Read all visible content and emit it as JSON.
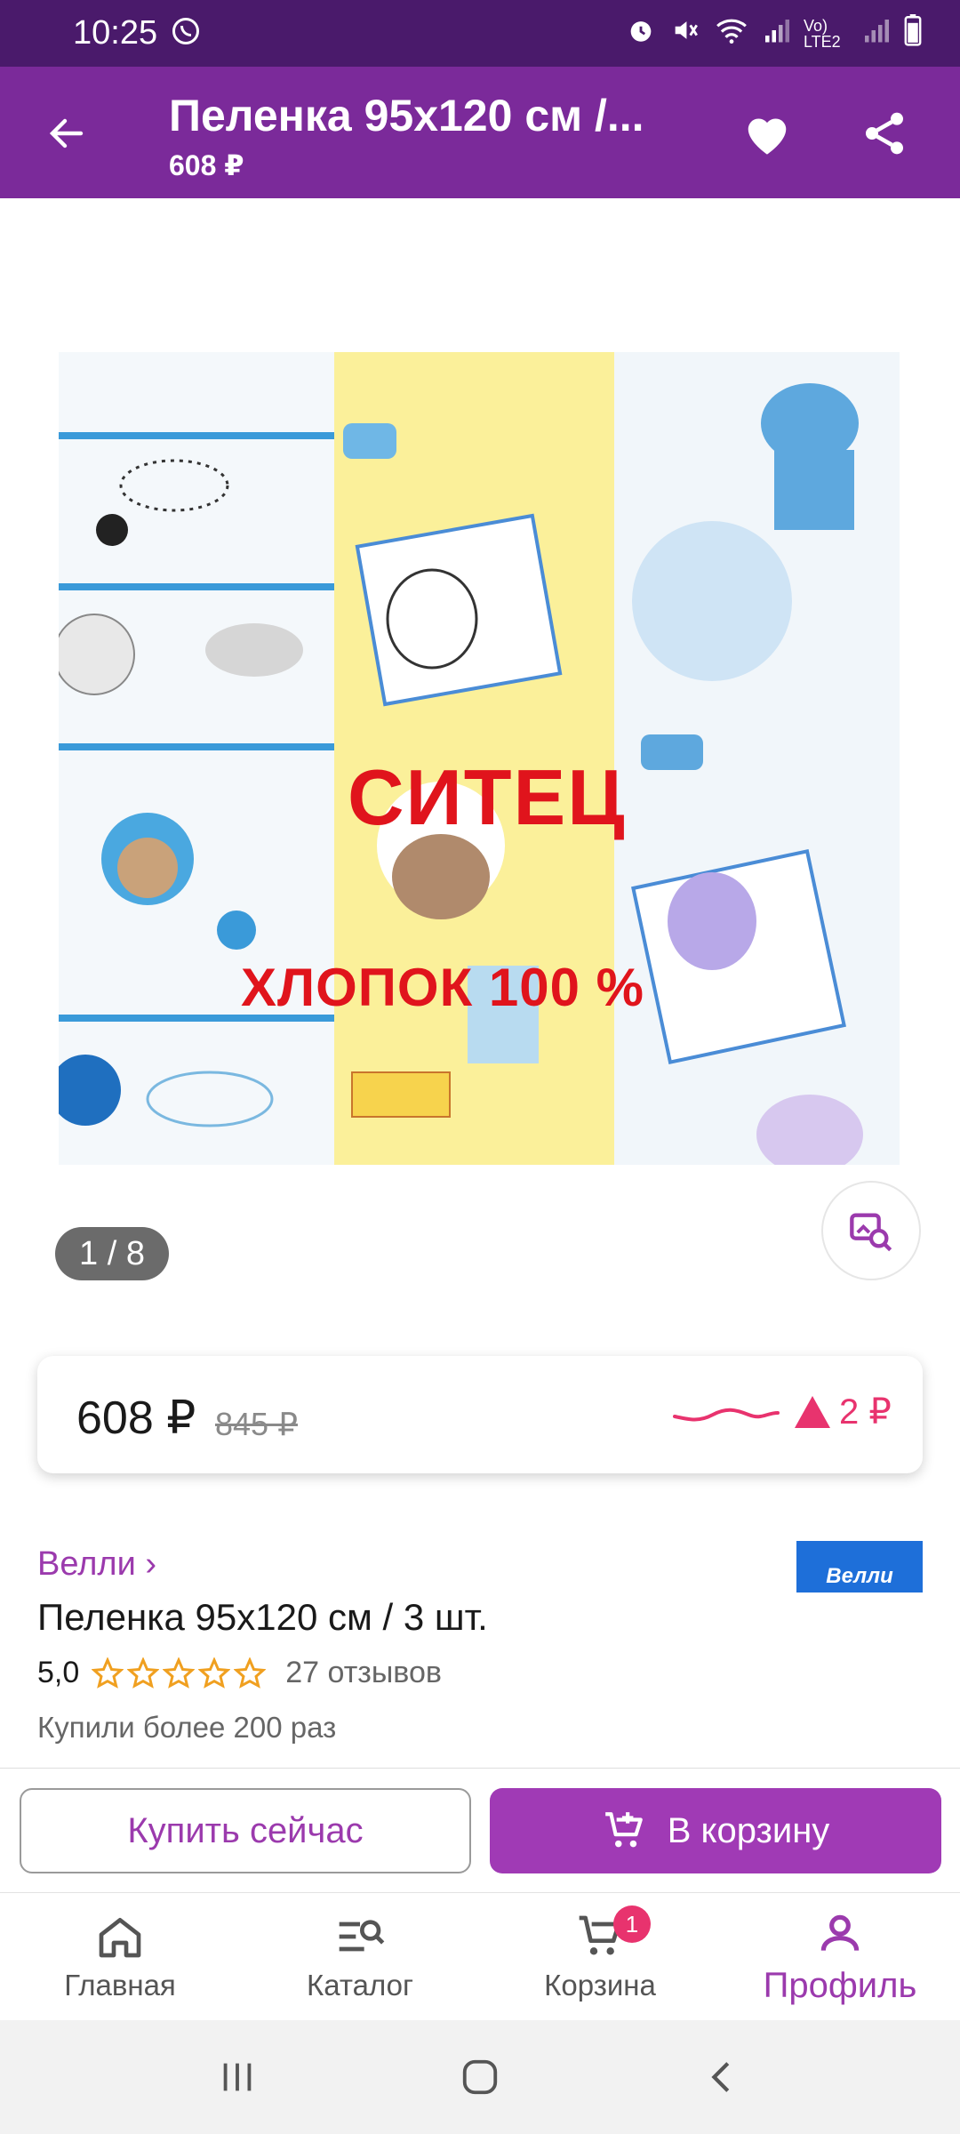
{
  "status_bar": {
    "time": "10:25",
    "network_label": "Vo) LTE2"
  },
  "header": {
    "title": "Пеленка 95х120 см /...",
    "price": "608 ₽"
  },
  "gallery": {
    "image_text_line1": "СИТЕЦ",
    "image_text_line2": "ХЛОПОК  100 %",
    "page_indicator": "1 / 8"
  },
  "price_card": {
    "current": "608 ₽",
    "old": "845 ₽",
    "change": "2 ₽",
    "change_direction": "up",
    "accent_color": "#e8336e"
  },
  "product": {
    "brand": "Велли ›",
    "brand_logo_text": "Велли",
    "title": "Пеленка 95х120 см / 3 шт.",
    "rating": "5,0",
    "stars_count": 5,
    "reviews": "27 отзывов",
    "bought": "Купили более 200 раз"
  },
  "actions": {
    "buy_now": "Купить сейчас",
    "add_to_cart": "В корзину"
  },
  "bottom_nav": {
    "items": [
      {
        "label": "Главная",
        "icon": "home-icon"
      },
      {
        "label": "Каталог",
        "icon": "catalog-search-icon"
      },
      {
        "label": "Корзина",
        "icon": "cart-icon",
        "badge": "1"
      },
      {
        "label": "Профиль",
        "icon": "profile-icon",
        "active": true
      }
    ]
  },
  "colors": {
    "status_bar": "#4a1a6b",
    "app_bar": "#7b2a9a",
    "brand_purple": "#9b3aad",
    "button_purple": "#a03ab5"
  }
}
